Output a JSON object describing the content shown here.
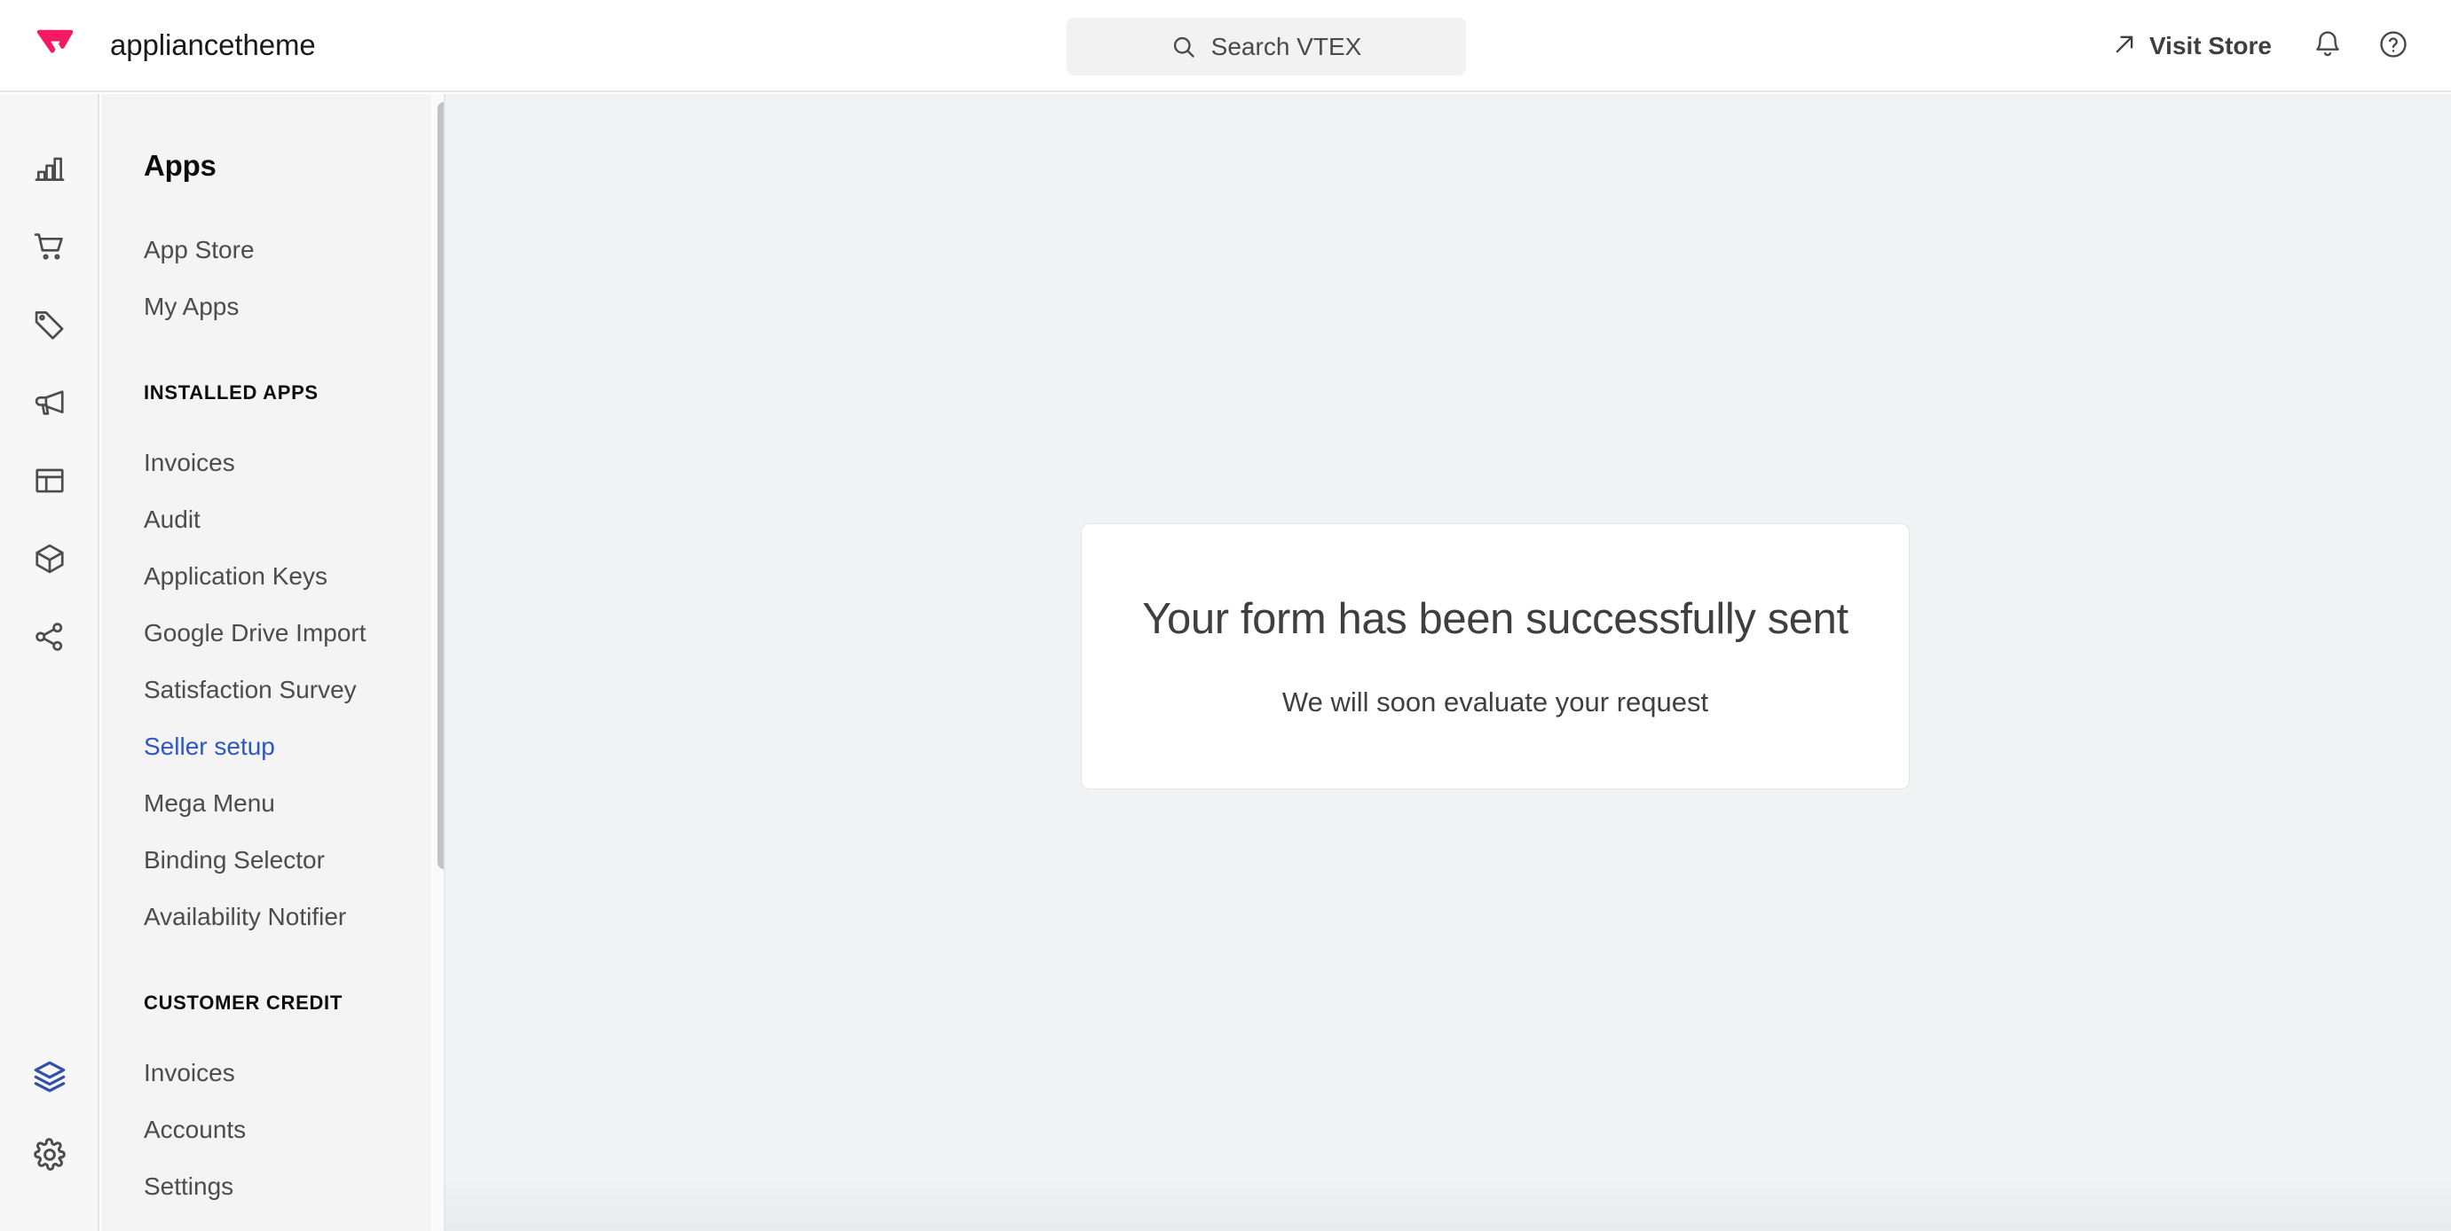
{
  "topbar": {
    "logo_icon": "vtex-logo-icon",
    "logo_color": "#f71963",
    "account_name": "appliancetheme",
    "search": {
      "icon": "search-icon",
      "placeholder": "Search VTEX",
      "value": ""
    },
    "visit_store": {
      "label": "Visit Store",
      "icon": "external-link-arrow-icon"
    },
    "notifications_icon": "bell-icon",
    "help_icon": "help-circle-icon"
  },
  "rail": {
    "items": [
      {
        "name": "analytics",
        "icon": "bar-chart-icon",
        "active": false
      },
      {
        "name": "orders",
        "icon": "shopping-cart-icon",
        "active": false
      },
      {
        "name": "catalog",
        "icon": "price-tag-icon",
        "active": false
      },
      {
        "name": "marketing",
        "icon": "megaphone-icon",
        "active": false
      },
      {
        "name": "storefront",
        "icon": "layout-icon",
        "active": false
      },
      {
        "name": "inventory",
        "icon": "box-icon",
        "active": false
      },
      {
        "name": "connections",
        "icon": "share-network-icon",
        "active": false
      }
    ],
    "bottom_items": [
      {
        "name": "apps",
        "icon": "layers-icon",
        "active": true
      },
      {
        "name": "settings",
        "icon": "gear-icon",
        "active": false
      }
    ],
    "active_color": "#2f4fa8",
    "idle_color": "#4c4c4c"
  },
  "sidebar": {
    "title": "Apps",
    "top_links": [
      {
        "label": "App Store",
        "active": false
      },
      {
        "label": "My Apps",
        "active": false
      }
    ],
    "sections": [
      {
        "heading": "INSTALLED APPS",
        "links": [
          {
            "label": "Invoices",
            "active": false
          },
          {
            "label": "Audit",
            "active": false
          },
          {
            "label": "Application Keys",
            "active": false
          },
          {
            "label": "Google Drive Import",
            "active": false
          },
          {
            "label": "Satisfaction Survey",
            "active": false
          },
          {
            "label": "Seller setup",
            "active": true
          },
          {
            "label": "Mega Menu",
            "active": false
          },
          {
            "label": "Binding Selector",
            "active": false
          },
          {
            "label": "Availability Notifier",
            "active": false
          }
        ]
      },
      {
        "heading": "CUSTOMER CREDIT",
        "links": [
          {
            "label": "Invoices",
            "active": false
          },
          {
            "label": "Accounts",
            "active": false
          },
          {
            "label": "Settings",
            "active": false
          }
        ]
      }
    ],
    "active_link_color": "#2f56c1"
  },
  "main": {
    "card": {
      "title": "Your form has been successfully sent",
      "subtitle": "We will soon evaluate your request"
    }
  }
}
